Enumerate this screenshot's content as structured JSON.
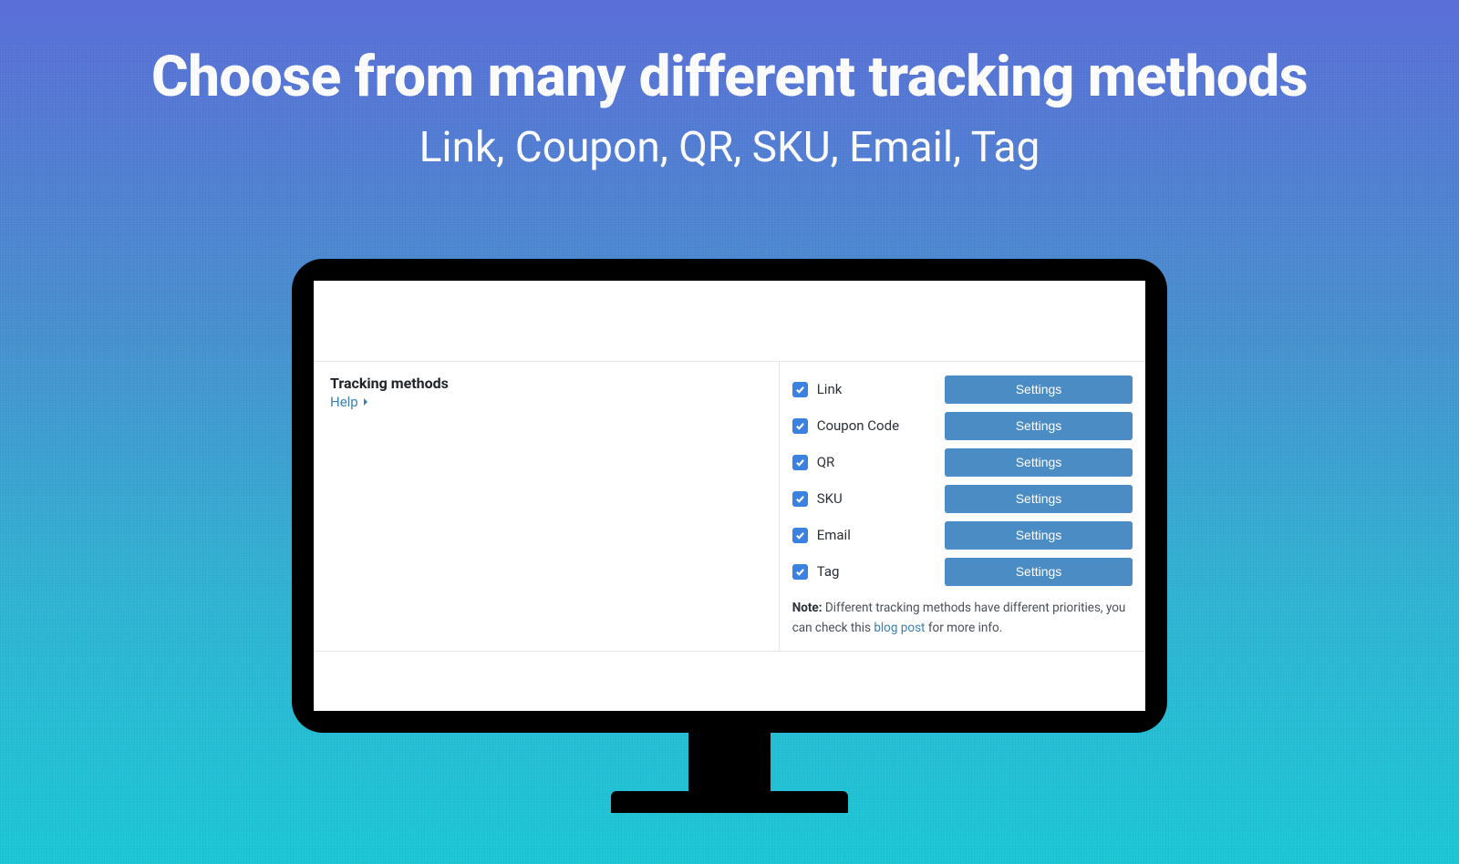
{
  "hero": {
    "headline": "Choose from many different tracking methods",
    "subhead": "Link, Coupon, QR, SKU, Email, Tag"
  },
  "panel": {
    "title": "Tracking methods",
    "help_label": "Help"
  },
  "methods": [
    {
      "label": "Link",
      "btn": "Settings"
    },
    {
      "label": "Coupon Code",
      "btn": "Settings"
    },
    {
      "label": "QR",
      "btn": "Settings"
    },
    {
      "label": "SKU",
      "btn": "Settings"
    },
    {
      "label": "Email",
      "btn": "Settings"
    },
    {
      "label": "Tag",
      "btn": "Settings"
    }
  ],
  "note": {
    "prefix_bold": "Note:",
    "text_before": " Different tracking methods have different priorities, you can check this ",
    "link_text": "blog post",
    "text_after": " for more info."
  }
}
